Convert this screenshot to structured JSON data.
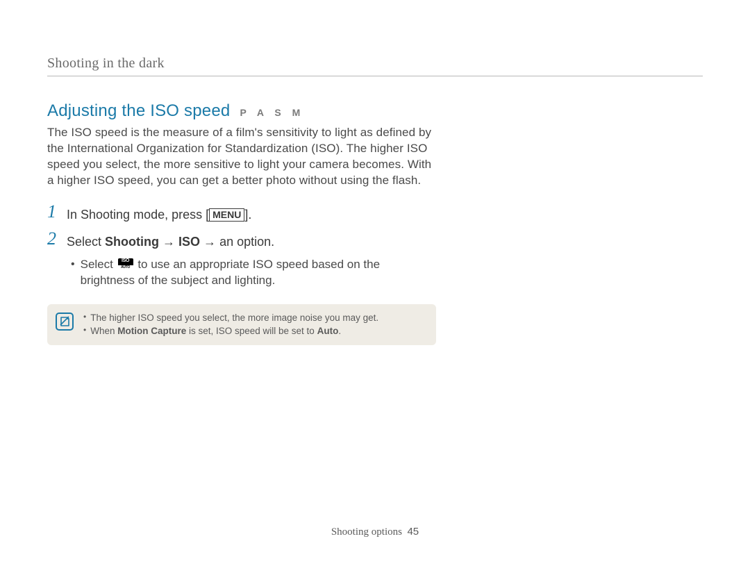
{
  "section_header": "Shooting in the dark",
  "heading": "Adjusting the ISO speed",
  "modes": "P A S M",
  "intro": "The ISO speed is the measure of a film's sensitivity to light as defined by the International Organization for Standardization (ISO). The higher ISO speed you select, the more sensitive to light your camera becomes. With a higher ISO speed, you can get a better photo without using the flash.",
  "steps": {
    "s1": {
      "num": "1",
      "pre": "In Shooting mode, press [",
      "menu": "MENU",
      "post": "]."
    },
    "s2": {
      "num": "2",
      "select_word": "Select ",
      "bold1": "Shooting",
      "arrow1": " → ",
      "bold2": "ISO",
      "arrow2": " → ",
      "tail": "an option."
    }
  },
  "sub_bullet": {
    "pre": "Select ",
    "post": " to use an appropriate ISO speed based on the brightness of the subject and lighting."
  },
  "notes": {
    "n1": "The higher ISO speed you select, the more image noise you may get.",
    "n2_pre": "When ",
    "n2_b1": "Motion Capture",
    "n2_mid": " is set, ISO speed will be set to ",
    "n2_b2": "Auto",
    "n2_post": "."
  },
  "footer": {
    "label": "Shooting options",
    "page": "45"
  }
}
